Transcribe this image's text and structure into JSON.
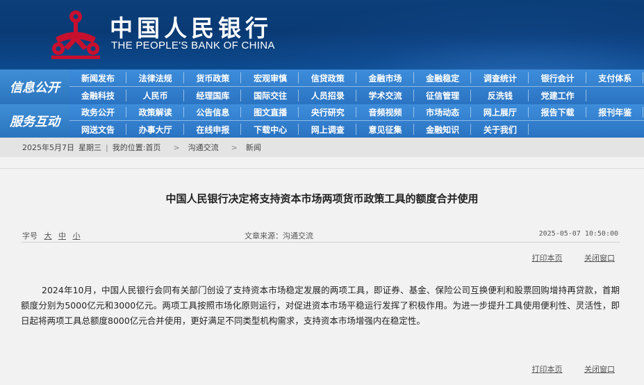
{
  "header": {
    "title_cn": "中国人民银行",
    "title_en": "THE PEOPLE'S BANK OF CHINA",
    "brand_color": "#c8102e"
  },
  "nav": {
    "section1_label": "信息公开",
    "section2_label": "服务互动",
    "row1": [
      "新闻发布",
      "法律法规",
      "货币政策",
      "宏观审慎",
      "信贷政策",
      "金融市场",
      "金融稳定",
      "调查统计",
      "银行会计",
      "支付体系"
    ],
    "row2": [
      "金融科技",
      "人民币",
      "经理国库",
      "国际交往",
      "人员招录",
      "学术交流",
      "征信管理",
      "反洗钱",
      "党建工作"
    ],
    "row3": [
      "政务公开",
      "政策解读",
      "公告信息",
      "图文直播",
      "央行研究",
      "音频视频",
      "市场动态",
      "网上展厅",
      "报告下载",
      "报刊年鉴"
    ],
    "row4": [
      "网送文告",
      "办事大厅",
      "在线申报",
      "下载中心",
      "网上调查",
      "意见征集",
      "金融知识",
      "关于我们"
    ]
  },
  "breadcrumb": {
    "date": "2025年5月7日",
    "weekday": "星期三",
    "divider": "|",
    "location_label": "我的位置:",
    "home": "首页",
    "sep": ">",
    "level1": "沟通交流",
    "level2": "新闻"
  },
  "article": {
    "title": "中国人民银行决定将支持资本市场两项货币政策工具的额度合并使用",
    "font_size_label": "字号",
    "font_large": "大",
    "font_medium": "中",
    "font_small": "小",
    "source": "文章来源：沟通交流",
    "datetime": "2025-05-07  10:50:00",
    "print_label": "打印本页",
    "close_label": "关闭窗口",
    "body": "2024年10月，中国人民银行会同有关部门创设了支持资本市场稳定发展的两项工具，即证券、基金、保险公司互换便利和股票回购增持再贷款，首期额度分别为5000亿元和3000亿元。两项工具按照市场化原则运行，对促进资本市场平稳运行发挥了积极作用。为进一步提升工具使用便利性、灵活性，即日起将两项工具总额度8000亿元合并使用，更好满足不同类型机构需求，支持资本市场增强内在稳定性。"
  }
}
